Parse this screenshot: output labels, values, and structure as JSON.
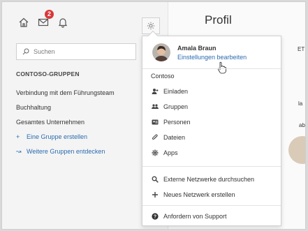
{
  "sidebar": {
    "mail_badge": "2",
    "search_placeholder": "Suchen",
    "groups_heading": "CONTOSO-GRUPPEN",
    "groups": [
      {
        "label": "Verbindung mit dem Führungsteam"
      },
      {
        "label": "Buchhaltung"
      },
      {
        "label": "Gesamtes Unternehmen"
      }
    ],
    "actions": [
      {
        "glyph": "+",
        "label": "Eine Gruppe erstellen"
      },
      {
        "glyph": "↝",
        "label": "Weitere Gruppen entdecken"
      }
    ]
  },
  "content": {
    "title": "Profil",
    "fragments": [
      "ET",
      "la",
      "ab"
    ]
  },
  "menu": {
    "user_name": "Amala Braun",
    "user_link": "Einstellungen bearbeiten",
    "network_name": "Contoso",
    "network_items": [
      {
        "icon": "invite-icon",
        "label": "Einladen"
      },
      {
        "icon": "groups-icon",
        "label": "Gruppen"
      },
      {
        "icon": "people-icon",
        "label": "Personen"
      },
      {
        "icon": "files-icon",
        "label": "Dateien"
      },
      {
        "icon": "apps-icon",
        "label": "Apps"
      }
    ],
    "external_items": [
      {
        "icon": "search-icon",
        "label": "Externe Netzwerke durchsuchen"
      },
      {
        "icon": "plus-icon",
        "label": "Neues Netzwerk erstellen"
      }
    ],
    "support_item": {
      "icon": "help-icon",
      "label": "Anfordern von Support"
    }
  },
  "colors": {
    "accent": "#2b6cb0",
    "badge": "#d9373a"
  }
}
